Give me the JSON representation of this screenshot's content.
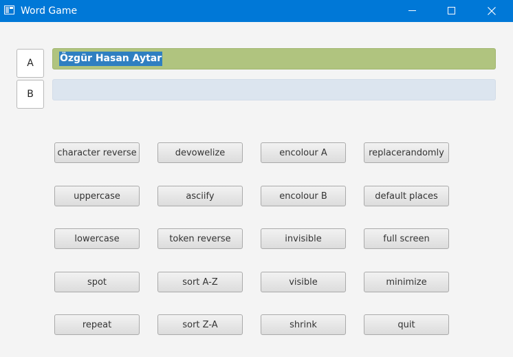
{
  "window": {
    "title": "Word Game"
  },
  "labels": {
    "a": "A",
    "b": "B"
  },
  "fields": {
    "a_value": "Özgür Hasan Aytar",
    "b_value": ""
  },
  "buttons": {
    "character_reverse": "character reverse",
    "devowelize": "devowelize",
    "encolour_a": "encolour A",
    "replacerandomly": "replacerandomly",
    "uppercase": "uppercase",
    "asciify": "asciify",
    "encolour_b": "encolour B",
    "default_places": "default places",
    "lowercase": "lowercase",
    "token_reverse": "token reverse",
    "invisible": "invisible",
    "full_screen": "full screen",
    "spot": "spot",
    "sort_az": "sort A-Z",
    "visible": "visible",
    "minimize": "minimize",
    "repeat": "repeat",
    "sort_za": "sort Z-A",
    "shrink": "shrink",
    "quit": "quit"
  },
  "colors": {
    "titlebar": "#0078d7",
    "field_a_background": "#b0c47f",
    "field_b_background": "#dce5ef",
    "selection": "#2f7fc1"
  },
  "icons": {
    "app": "app-window-icon",
    "minimize": "minimize-icon",
    "maximize": "maximize-icon",
    "close": "close-icon"
  }
}
